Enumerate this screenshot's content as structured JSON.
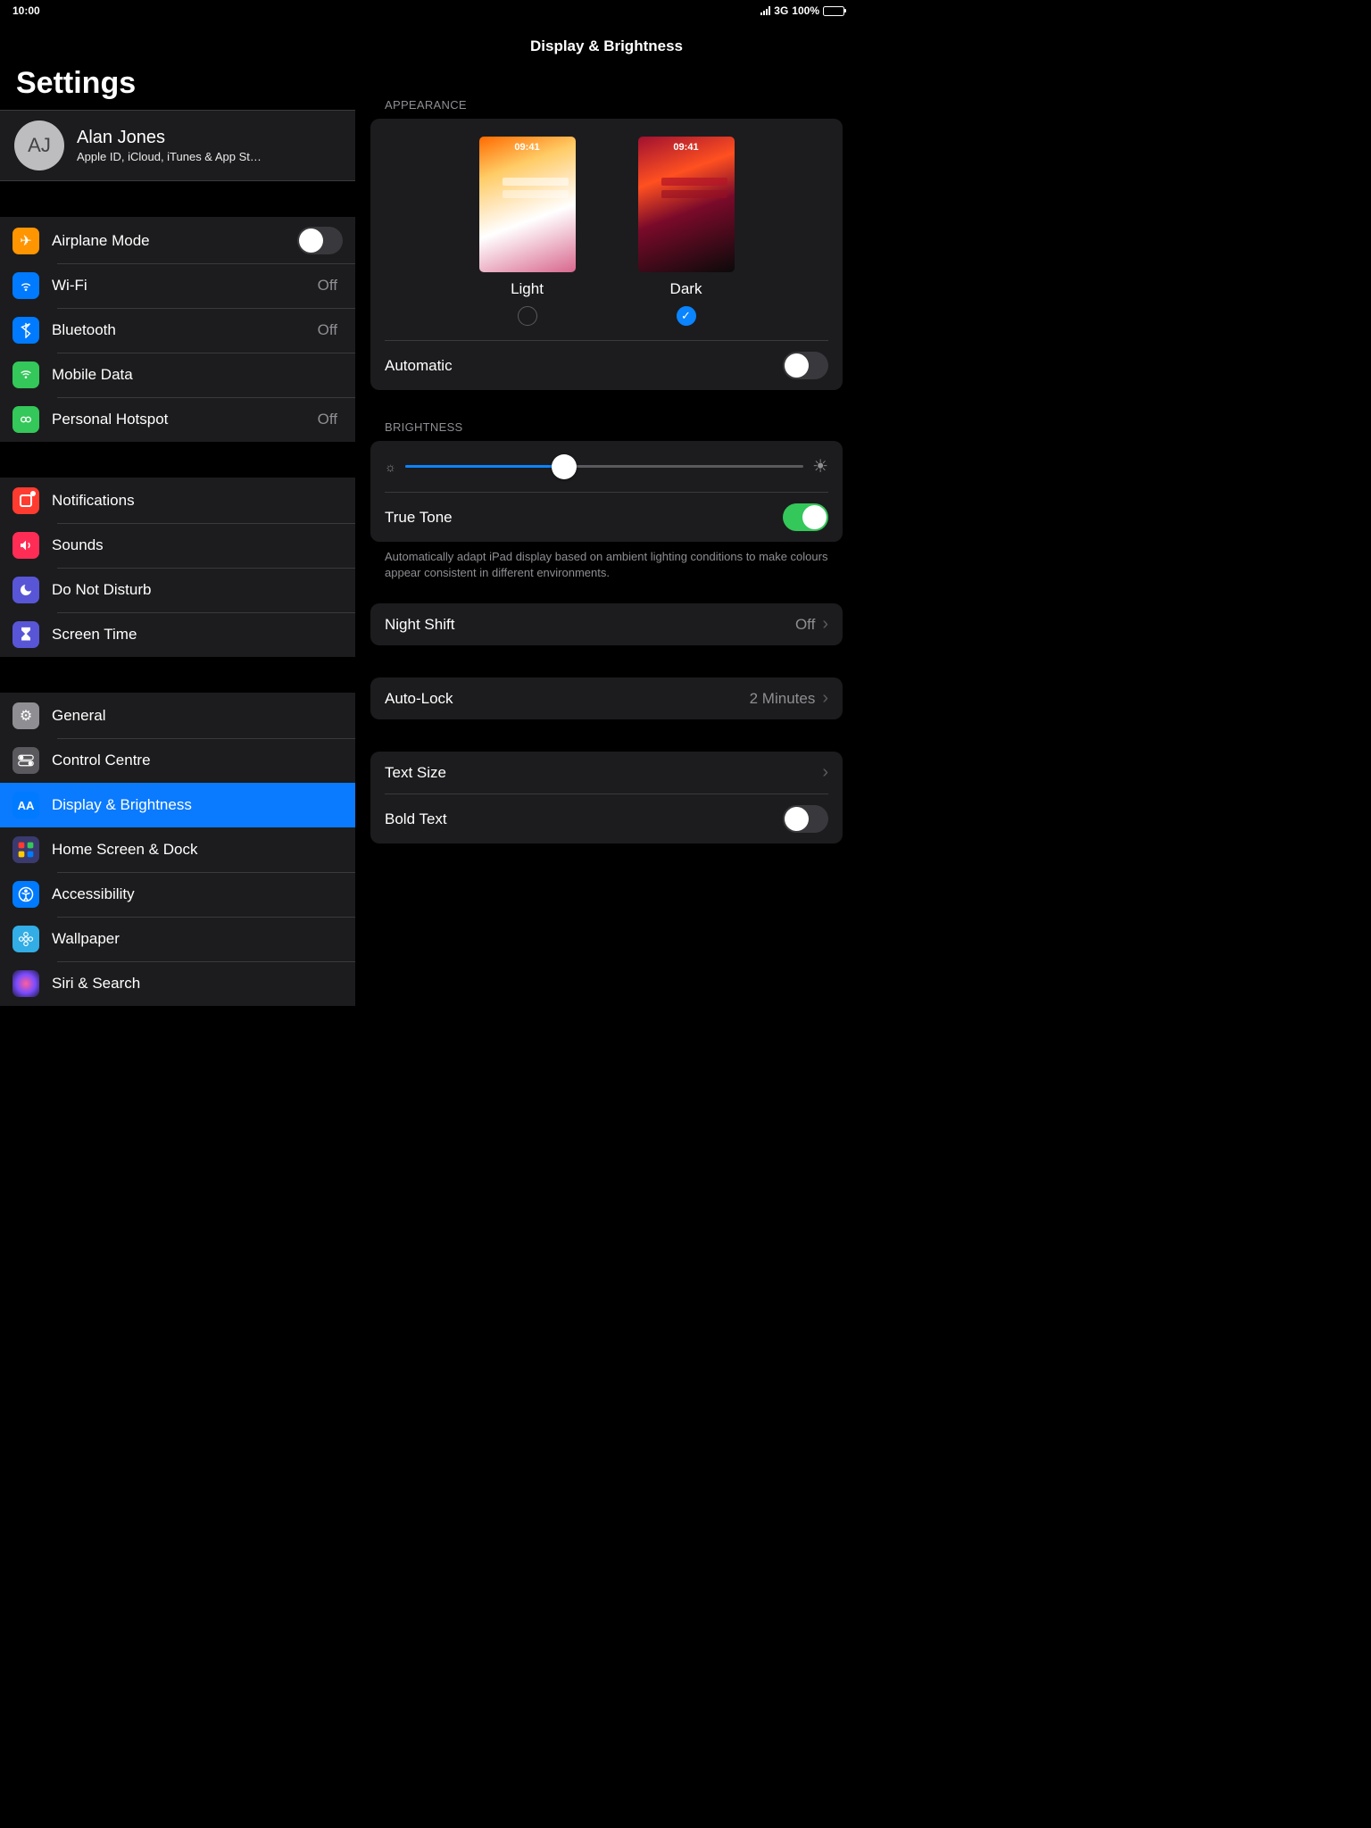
{
  "status": {
    "time": "10:00",
    "network": "3G",
    "battery": "100%"
  },
  "sidebar": {
    "title": "Settings",
    "profile": {
      "initials": "AJ",
      "name": "Alan Jones",
      "subtitle": "Apple ID, iCloud, iTunes & App St…"
    },
    "g1": {
      "airplane": "Airplane Mode",
      "wifi": "Wi-Fi",
      "wifi_val": "Off",
      "bt": "Bluetooth",
      "bt_val": "Off",
      "mobile": "Mobile Data",
      "hotspot": "Personal Hotspot",
      "hotspot_val": "Off"
    },
    "g2": {
      "notif": "Notifications",
      "sounds": "Sounds",
      "dnd": "Do Not Disturb",
      "st": "Screen Time"
    },
    "g3": {
      "general": "General",
      "cc": "Control Centre",
      "disp": "Display & Brightness",
      "home": "Home Screen & Dock",
      "acc": "Accessibility",
      "wall": "Wallpaper",
      "siri": "Siri & Search"
    }
  },
  "detail": {
    "title": "Display & Brightness",
    "appearance_header": "APPEARANCE",
    "light": "Light",
    "dark": "Dark",
    "preview_time": "09:41",
    "automatic": "Automatic",
    "brightness_header": "BRIGHTNESS",
    "truetone": "True Tone",
    "truetone_note": "Automatically adapt iPad display based on ambient lighting conditions to make colours appear consistent in different environments.",
    "nightshift": "Night Shift",
    "nightshift_val": "Off",
    "autolock": "Auto-Lock",
    "autolock_val": "2 Minutes",
    "textsize": "Text Size",
    "bold": "Bold Text"
  }
}
